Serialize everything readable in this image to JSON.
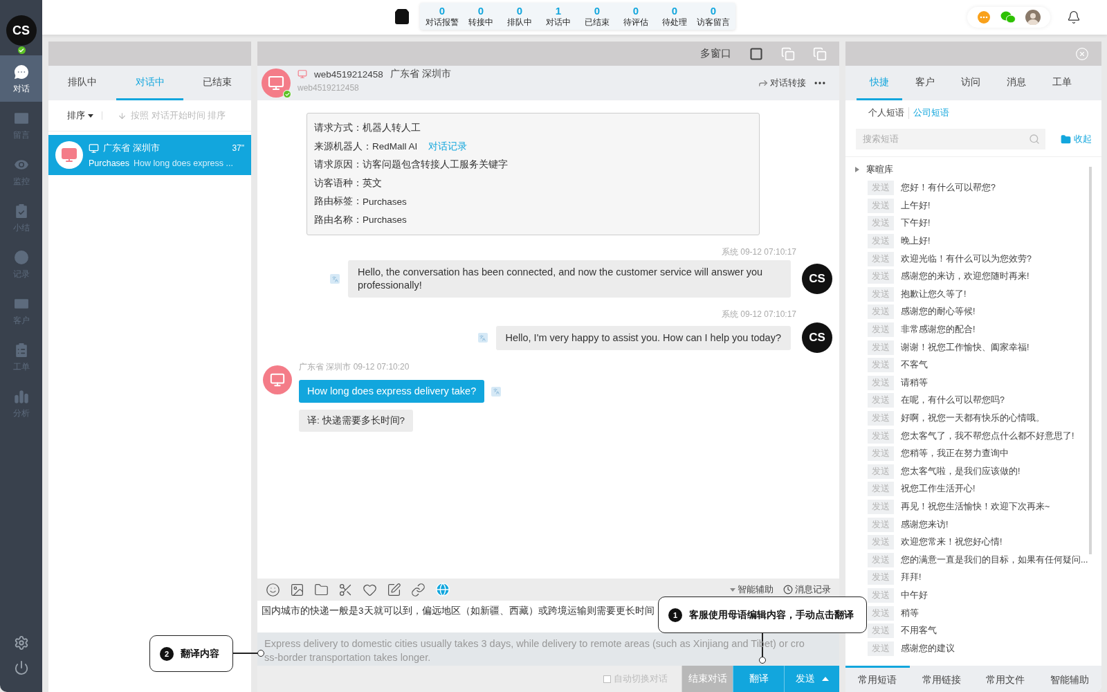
{
  "sidebar": {
    "avatar": "CS",
    "online": true,
    "items": [
      {
        "label": "对话",
        "selected": true
      },
      {
        "label": "留言",
        "selected": false
      },
      {
        "label": "监控",
        "selected": false
      },
      {
        "label": "小结",
        "selected": false
      },
      {
        "label": "记录",
        "selected": false
      },
      {
        "label": "客户",
        "selected": false
      },
      {
        "label": "工单",
        "selected": false
      },
      {
        "label": "分析",
        "selected": false
      }
    ]
  },
  "stats": [
    {
      "count": "0",
      "label": "对话报警"
    },
    {
      "count": "0",
      "label": "转接中"
    },
    {
      "count": "0",
      "label": "排队中"
    },
    {
      "count": "1",
      "label": "对话中"
    },
    {
      "count": "0",
      "label": "已结束"
    },
    {
      "count": "0",
      "label": "待评估"
    },
    {
      "count": "0",
      "label": "待处理"
    },
    {
      "count": "0",
      "label": "访客留言"
    }
  ],
  "left_panel": {
    "tabs": [
      {
        "label": "排队中",
        "selected": false
      },
      {
        "label": "对话中",
        "selected": true
      },
      {
        "label": "已结束",
        "selected": false
      }
    ],
    "sort_label": "排序",
    "sort_hint": "按照 对话开始时间 排序",
    "conversations": [
      {
        "location": "广东省 深圳市",
        "time": "37\"",
        "source": "Purchases",
        "preview": "How long does express ...",
        "selected": true
      }
    ]
  },
  "chat": {
    "window_label": "多窗口",
    "visitor": "web4519212458",
    "location": "广东省 深圳市",
    "visitor_id": "web4519212458",
    "transfer": "对话转接",
    "info": [
      {
        "label": "请求方式：",
        "value": "机器人转人工"
      },
      {
        "label": "来源机器人：",
        "value": "RedMall AI",
        "link": "对话记录"
      },
      {
        "label": "请求原因：",
        "value": "访客问题包含转接人工服务关键字"
      },
      {
        "label": "访客语种：",
        "value": "英文"
      },
      {
        "label": "路由标签：",
        "value": "Purchases"
      },
      {
        "label": "路由名称：",
        "value": "Purchases"
      }
    ],
    "messages": [
      {
        "kind": "agent",
        "meta": "系统  09-12 07:10:17",
        "text": "Hello, the conversation has been connected, and now the customer service will answer you professionally!",
        "avatar": "CS"
      },
      {
        "kind": "agent",
        "meta": "系统  09-12 07:10:17",
        "text": "Hello, I'm very happy to assist you. How can I help you today?",
        "avatar": "CS"
      },
      {
        "kind": "visitor",
        "meta": "广东省 深圳市 09-12 07:10:20",
        "text": "How long does express delivery take?",
        "translation": "译:   快递需要多长时间?"
      }
    ]
  },
  "compose": {
    "assist": "智能辅助",
    "history": "消息记录",
    "draft": "国内城市的快递一般是3天就可以到，偏远地区（如新疆、西藏）或跨境运输则需要更长时间",
    "translation": "Express delivery to domestic cities usually takes 3 days, while delivery to remote areas (such as Xinjiang and Tibet) or cross-border transportation takes longer.",
    "auto_switch": {
      "label": "自动切换对话",
      "checked": false
    },
    "end_button": "结束对话",
    "translate_button": "翻译",
    "send_button": "发送"
  },
  "callouts": [
    {
      "number": "1",
      "text": "客服使用母语编辑内容，手动点击翻译"
    },
    {
      "number": "2",
      "text": "翻译内容"
    }
  ],
  "right_panel": {
    "tabs": [
      {
        "label": "快捷",
        "selected": true
      },
      {
        "label": "客户",
        "selected": false
      },
      {
        "label": "访问",
        "selected": false
      },
      {
        "label": "消息",
        "selected": false
      },
      {
        "label": "工单",
        "selected": false
      }
    ],
    "subtabs": [
      {
        "label": "个人短语",
        "selected": false
      },
      {
        "label": "公司短语",
        "selected": true
      }
    ],
    "search": {
      "placeholder": "搜索短语"
    },
    "collapse": "收起",
    "category": "寒暄库",
    "phrases": [
      {
        "send": "发送",
        "text": "您好！有什么可以帮您?"
      },
      {
        "send": "发送",
        "text": "上午好!"
      },
      {
        "send": "发送",
        "text": "下午好!"
      },
      {
        "send": "发送",
        "text": "晚上好!"
      },
      {
        "send": "发送",
        "text": "欢迎光临！有什么可以为您效劳?"
      },
      {
        "send": "发送",
        "text": "感谢您的来访，欢迎您随时再来!"
      },
      {
        "send": "发送",
        "text": "抱歉让您久等了!"
      },
      {
        "send": "发送",
        "text": "感谢您的耐心等候!"
      },
      {
        "send": "发送",
        "text": "非常感谢您的配合!"
      },
      {
        "send": "发送",
        "text": "谢谢！祝您工作愉快、阖家幸福!"
      },
      {
        "send": "发送",
        "text": "不客气"
      },
      {
        "send": "发送",
        "text": "请稍等"
      },
      {
        "send": "发送",
        "text": "在呢，有什么可以帮您吗?"
      },
      {
        "send": "发送",
        "text": "好啊，祝您一天都有快乐的心情哦。"
      },
      {
        "send": "发送",
        "text": "您太客气了，我不帮您点什么都不好意思了!"
      },
      {
        "send": "发送",
        "text": "您稍等，我正在努力查询中"
      },
      {
        "send": "发送",
        "text": "您太客气啦，是我们应该做的!"
      },
      {
        "send": "发送",
        "text": "祝您工作生活开心!"
      },
      {
        "send": "发送",
        "text": "再见！祝您生活愉快！欢迎下次再来~"
      },
      {
        "send": "发送",
        "text": "感谢您来访!"
      },
      {
        "send": "发送",
        "text": "欢迎您常来！祝您好心情!"
      },
      {
        "send": "发送",
        "text": "您的满意一直是我们的目标，如果有任何疑问..."
      },
      {
        "send": "发送",
        "text": "拜拜!"
      },
      {
        "send": "发送",
        "text": "中午好"
      },
      {
        "send": "发送",
        "text": "稍等"
      },
      {
        "send": "发送",
        "text": "不用客气"
      },
      {
        "send": "发送",
        "text": "感谢您的建议"
      }
    ],
    "bottom_tabs": [
      {
        "label": "常用短语",
        "selected": true
      },
      {
        "label": "常用链接",
        "selected": false
      },
      {
        "label": "常用文件",
        "selected": false
      },
      {
        "label": "智能辅助",
        "selected": false
      }
    ]
  }
}
